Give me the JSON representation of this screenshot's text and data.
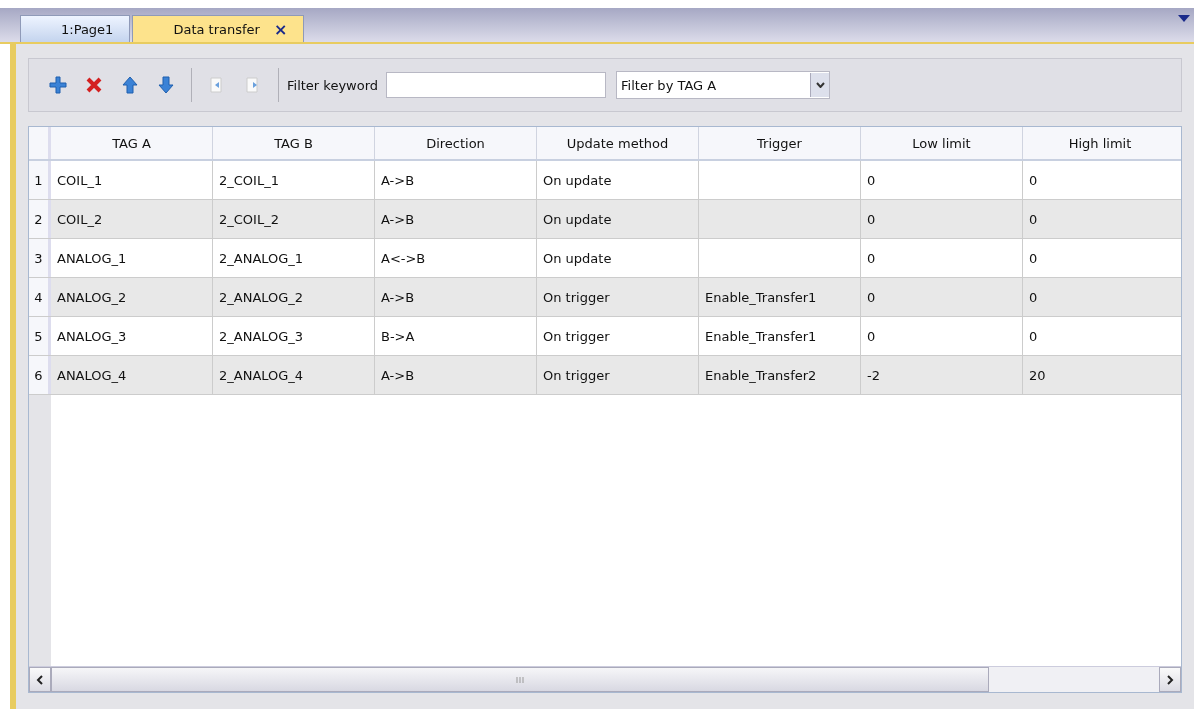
{
  "tabs": [
    {
      "label": "1:Page1",
      "selected": false
    },
    {
      "label": "Data transfer",
      "selected": true,
      "close": "×"
    }
  ],
  "toolbar": {
    "buttons": [
      {
        "kind": "add"
      },
      {
        "kind": "delete"
      },
      {
        "kind": "up"
      },
      {
        "kind": "down"
      },
      {
        "kind": "sep"
      },
      {
        "kind": "import"
      },
      {
        "kind": "export"
      },
      {
        "kind": "sep"
      }
    ],
    "filter_label": "Filter keyword",
    "filter_by": "Filter by TAG A"
  },
  "table": {
    "columns": [
      "TAG A",
      "TAG B",
      "Direction",
      "Update method",
      "Trigger",
      "Low limit",
      "High limit"
    ],
    "rows": [
      {
        "number": "1",
        "cells": [
          "COIL_1",
          "2_COIL_1",
          "A->B",
          "On update",
          "",
          "0",
          "0"
        ]
      },
      {
        "number": "2",
        "cells": [
          "COIL_2",
          "2_COIL_2",
          "A->B",
          "On update",
          "",
          "0",
          "0"
        ]
      },
      {
        "number": "3",
        "cells": [
          "ANALOG_1",
          "2_ANALOG_1",
          "A<->B",
          "On update",
          "",
          "0",
          "0"
        ]
      },
      {
        "number": "4",
        "cells": [
          "ANALOG_2",
          "2_ANALOG_2",
          "A->B",
          "On trigger",
          "Enable_Transfer1",
          "0",
          "0"
        ]
      },
      {
        "number": "5",
        "cells": [
          "ANALOG_3",
          "2_ANALOG_3",
          "B->A",
          "On trigger",
          "Enable_Transfer1",
          "0",
          "0"
        ]
      },
      {
        "number": "6",
        "cells": [
          "ANALOG_4",
          "2_ANALOG_4",
          "A->B",
          "On trigger",
          "Enable_Transfer2",
          "-2",
          "20"
        ]
      }
    ]
  }
}
